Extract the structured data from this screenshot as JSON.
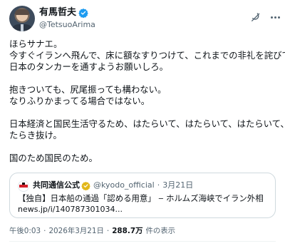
{
  "author": {
    "display_name": "有馬哲夫",
    "handle": "@TetsuoArima",
    "verified_color": "#1d9bf0"
  },
  "icons": {
    "grok": "grok-icon",
    "more": "more-icon",
    "verified": "verified-badge-icon"
  },
  "tweet": {
    "lines": [
      "ほらサナエ。",
      "今すぐイランへ飛んで、床に額なすりつけて、これまでの非礼を詫びて、",
      "日本のタンカーを通すようお願いしろ。",
      "",
      "抱きついても、尻尾振っても構わない。",
      "なりふりかまってる場合ではない。",
      "",
      "日本経済と国民生活守るため、はたらいて、はたらいて、はたらいて、は",
      "たらき抜け。",
      "",
      "国のため国民のため。"
    ]
  },
  "quote": {
    "name": "共同通信公式",
    "handle": "@kyodo_official",
    "date": "3月21日",
    "separator": "·",
    "text": "【独自】日本船の通過「認める用意」 ‒ ホルムズ海峡でイラン外相",
    "link": "news.jp/i/140787301034..."
  },
  "footer": {
    "time": "午後0:03",
    "date": "2026年3月21日",
    "views": "288.7万",
    "views_label": "件の表示",
    "separator": "·"
  }
}
